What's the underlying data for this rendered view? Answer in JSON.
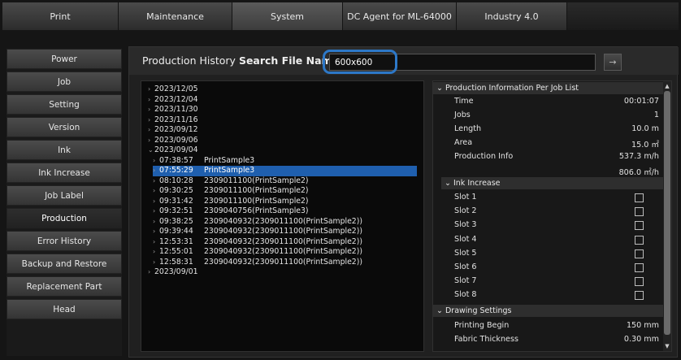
{
  "tabs": [
    {
      "label": "Print"
    },
    {
      "label": "Maintenance"
    },
    {
      "label": "System"
    },
    {
      "label": "DC Agent for ML-64000"
    },
    {
      "label": "Industry 4.0"
    }
  ],
  "sidebar": {
    "items": [
      {
        "label": "Power"
      },
      {
        "label": "Job"
      },
      {
        "label": "Setting"
      },
      {
        "label": "Version"
      },
      {
        "label": "Ink"
      },
      {
        "label": "Ink Increase"
      },
      {
        "label": "Job Label"
      },
      {
        "label": "Production"
      },
      {
        "label": "Error History"
      },
      {
        "label": "Backup and Restore"
      },
      {
        "label": "Replacement Part"
      },
      {
        "label": "Head"
      }
    ],
    "active": "Production"
  },
  "search": {
    "title": "Production History",
    "label": "Search File Name",
    "value": "600x600",
    "go_icon": "arrow-right-icon"
  },
  "history": {
    "dates_before": [
      {
        "mark": "›",
        "label": "2023/12/05"
      },
      {
        "mark": "›",
        "label": "2023/12/04"
      },
      {
        "mark": "›",
        "label": "2023/11/30"
      },
      {
        "mark": "›",
        "label": "2023/11/16"
      },
      {
        "mark": "›",
        "label": "2023/09/12"
      },
      {
        "mark": "›",
        "label": "2023/09/06"
      }
    ],
    "expanded_date": {
      "mark": "⌄",
      "label": "2023/09/04"
    },
    "jobs": [
      {
        "time": "07:38:57",
        "name": "PrintSample3"
      },
      {
        "time": "07:55:29",
        "name": "PrintSample3"
      },
      {
        "time": "08:10:28",
        "name": "2309011100(PrintSample2)"
      },
      {
        "time": "09:30:25",
        "name": "2309011100(PrintSample2)"
      },
      {
        "time": "09:31:42",
        "name": "2309011100(PrintSample2)"
      },
      {
        "time": "09:32:51",
        "name": "2309040756(PrintSample3)"
      },
      {
        "time": "09:38:25",
        "name": "2309040932(2309011100(PrintSample2))"
      },
      {
        "time": "09:39:44",
        "name": "2309040932(2309011100(PrintSample2))"
      },
      {
        "time": "12:53:31",
        "name": "2309040932(2309011100(PrintSample2))"
      },
      {
        "time": "12:55:01",
        "name": "2309040932(2309011100(PrintSample2))"
      },
      {
        "time": "12:58:31",
        "name": "2309040932(2309011100(PrintSample2))"
      }
    ],
    "selected_job_index": 1,
    "dates_after": [
      {
        "mark": "›",
        "label": "2023/09/01"
      }
    ]
  },
  "info": {
    "production_header": "Production Information Per Job List",
    "rows": [
      {
        "label": "Time",
        "value": "00:01:07"
      },
      {
        "label": "Jobs",
        "value": "1"
      },
      {
        "label": "Length",
        "value": "10.0  m"
      },
      {
        "label": "Area",
        "value": "15.0  ㎡"
      },
      {
        "label": "Production Info",
        "value": "537.3  m/h"
      },
      {
        "label": "",
        "value": "806.0  ㎡/h"
      }
    ],
    "ink_header": "Ink Increase",
    "slots": [
      "Slot 1",
      "Slot 2",
      "Slot 3",
      "Slot 4",
      "Slot 5",
      "Slot 6",
      "Slot 7",
      "Slot 8"
    ],
    "drawing_header": "Drawing Settings",
    "drawing_rows": [
      {
        "label": "Printing Begin",
        "value": "150  mm"
      },
      {
        "label": "Fabric Thickness",
        "value": "0.30  mm"
      }
    ]
  },
  "colors": {
    "accent": "#2d78c8",
    "selection": "#1f5fae"
  }
}
